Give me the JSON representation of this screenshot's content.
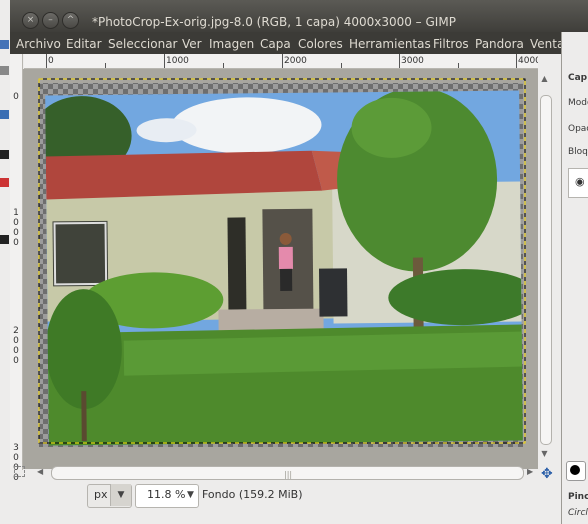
{
  "window": {
    "title": "*PhotoCrop-Ex-orig.jpg-8.0 (RGB, 1 capa) 4000x3000 – GIMP",
    "buttons": [
      "×",
      "–",
      "^"
    ]
  },
  "menu": [
    "Archivo",
    "Editar",
    "Seleccionar",
    "Ver",
    "Imagen",
    "Capa",
    "Colores",
    "Herramientas",
    "Filtros",
    "Pandora",
    "Venta"
  ],
  "ruler_top": [
    "0",
    "1000",
    "2000",
    "3000",
    "4000"
  ],
  "ruler_left": [
    "0",
    "1000",
    "2000",
    "3000"
  ],
  "status": {
    "unit": "px",
    "zoom": "11.8 %",
    "text": "Fondo (159.2 MiB)"
  },
  "dock": {
    "labels": [
      "Cap",
      "Modo",
      "Opac",
      "Bloq"
    ],
    "brush_label": "Pinc",
    "brush_sub": "Circle"
  },
  "icons": {
    "navigate": "navigate-icon",
    "quickmask": "quickmask-icon",
    "eye": "eye-icon"
  },
  "colors": {
    "titlebar": "#3c3b37",
    "window_bg": "#edeceb",
    "selection": "#f2d400",
    "grass": "#4e8a2c",
    "sky": "#72a7e0",
    "roof": "#b0463d",
    "wall": "#c7c9a8"
  }
}
